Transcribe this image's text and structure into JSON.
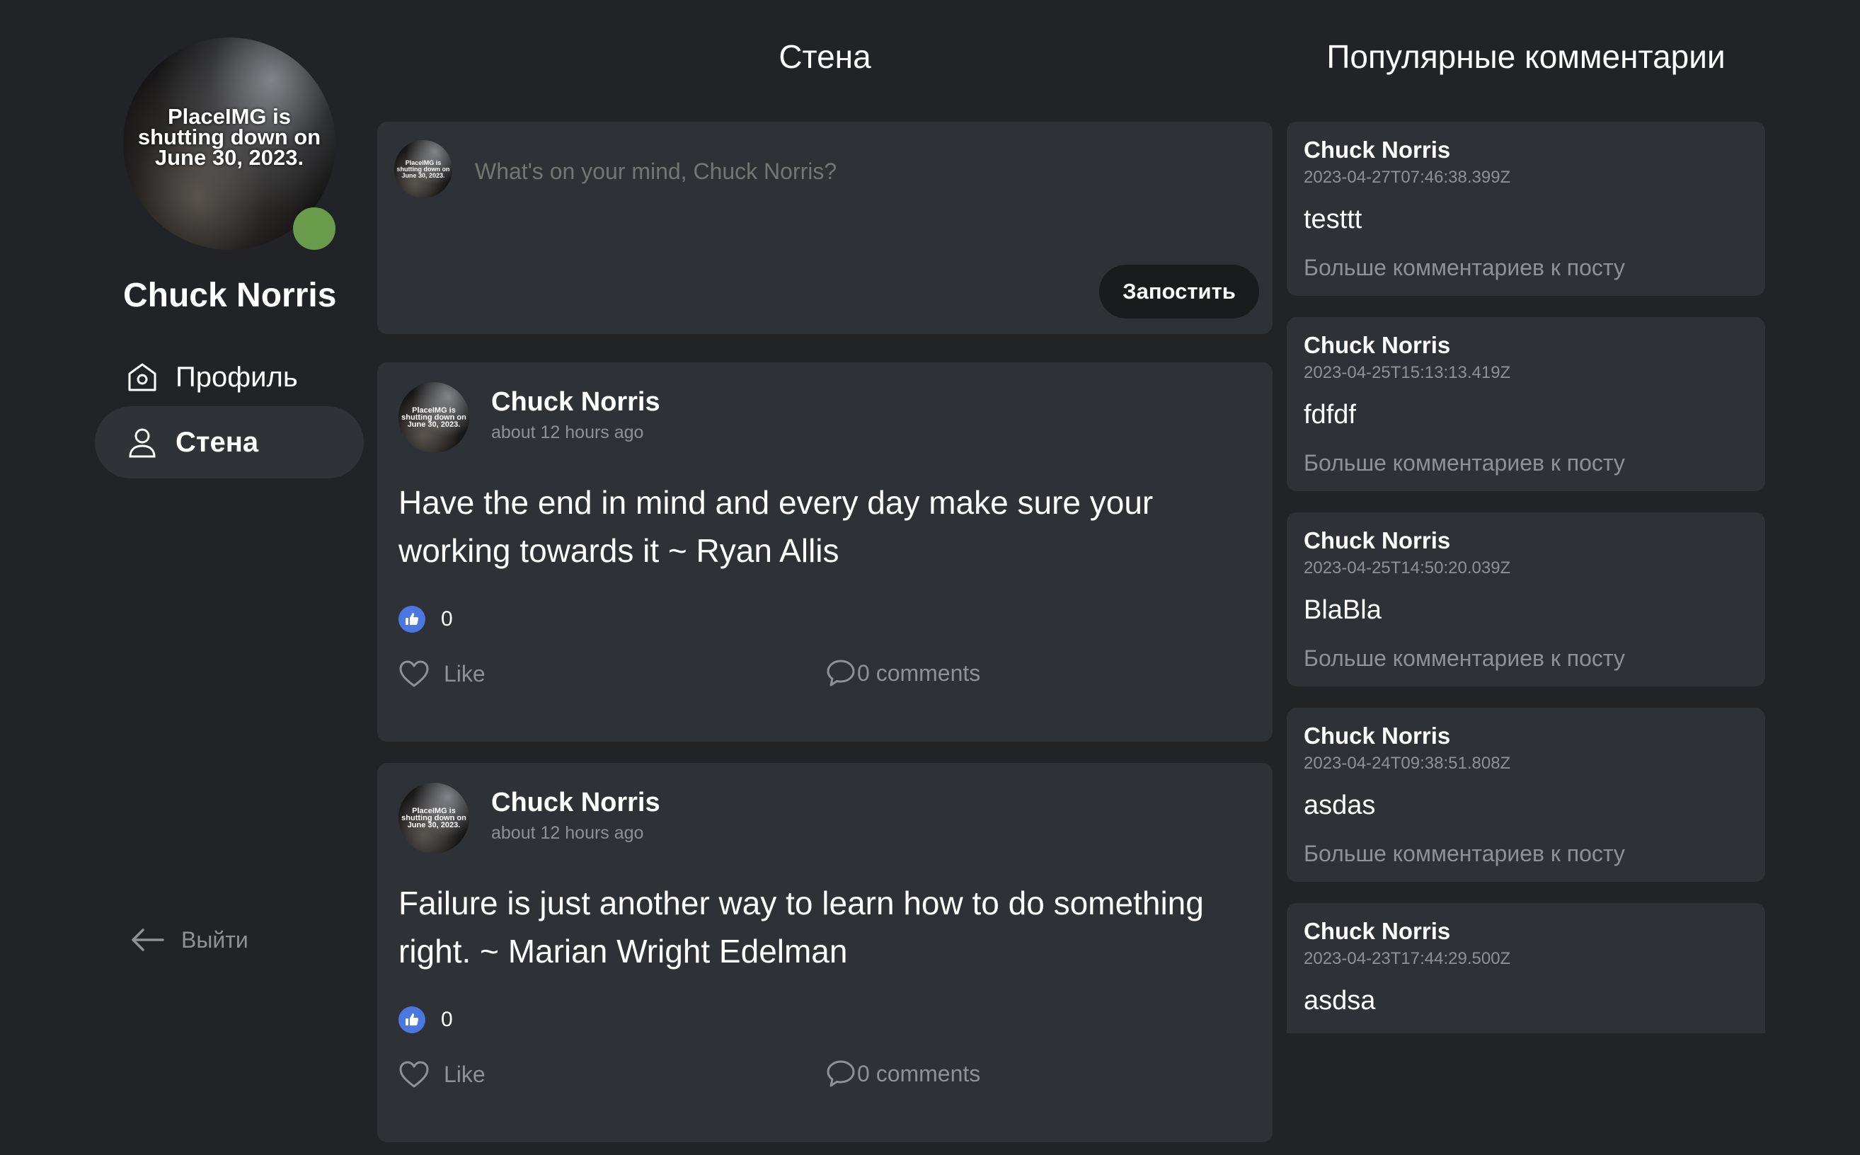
{
  "sidebar": {
    "avatar_text": "PlaceIMG is shutting down on June 30, 2023.",
    "user_name": "Chuck Norris",
    "nav": [
      {
        "label": "Профиль",
        "icon": "home-icon"
      },
      {
        "label": "Стена",
        "icon": "user-icon"
      }
    ],
    "logout_label": "Выйти",
    "online_color": "#6a9b4a"
  },
  "wall": {
    "title": "Стена",
    "composer": {
      "placeholder": "What's on your mind, Chuck Norris?",
      "submit_label": "Запостить"
    },
    "posts": [
      {
        "author": "Chuck Norris",
        "time": "about 12 hours ago",
        "text": "Have the end in mind and every day make sure your working towards it ~ Ryan Allis",
        "likes": "0",
        "like_label": "Like",
        "comments_label": "0 comments"
      },
      {
        "author": "Chuck Norris",
        "time": "about 12 hours ago",
        "text": "Failure is just another way to learn how to do something right. ~ Marian Wright Edelman",
        "likes": "0",
        "like_label": "Like",
        "comments_label": "0 comments"
      }
    ]
  },
  "popular": {
    "title": "Популярные комментарии",
    "comments": [
      {
        "author": "Chuck Norris",
        "date": "2023-04-27T07:46:38.399Z",
        "text": "testtt",
        "more": "Больше комментариев к посту"
      },
      {
        "author": "Chuck Norris",
        "date": "2023-04-25T15:13:13.419Z",
        "text": "fdfdf",
        "more": "Больше комментариев к посту"
      },
      {
        "author": "Chuck Norris",
        "date": "2023-04-25T14:50:20.039Z",
        "text": "BlaBla",
        "more": "Больше комментариев к посту"
      },
      {
        "author": "Chuck Norris",
        "date": "2023-04-24T09:38:51.808Z",
        "text": "asdas",
        "more": "Больше комментариев к посту"
      },
      {
        "author": "Chuck Norris",
        "date": "2023-04-23T17:44:29.500Z",
        "text": "asdsa"
      }
    ]
  },
  "colors": {
    "background": "#222326",
    "card": "#2e3135",
    "muted_text": "#8e9297",
    "like_accent": "#4a78e0"
  }
}
